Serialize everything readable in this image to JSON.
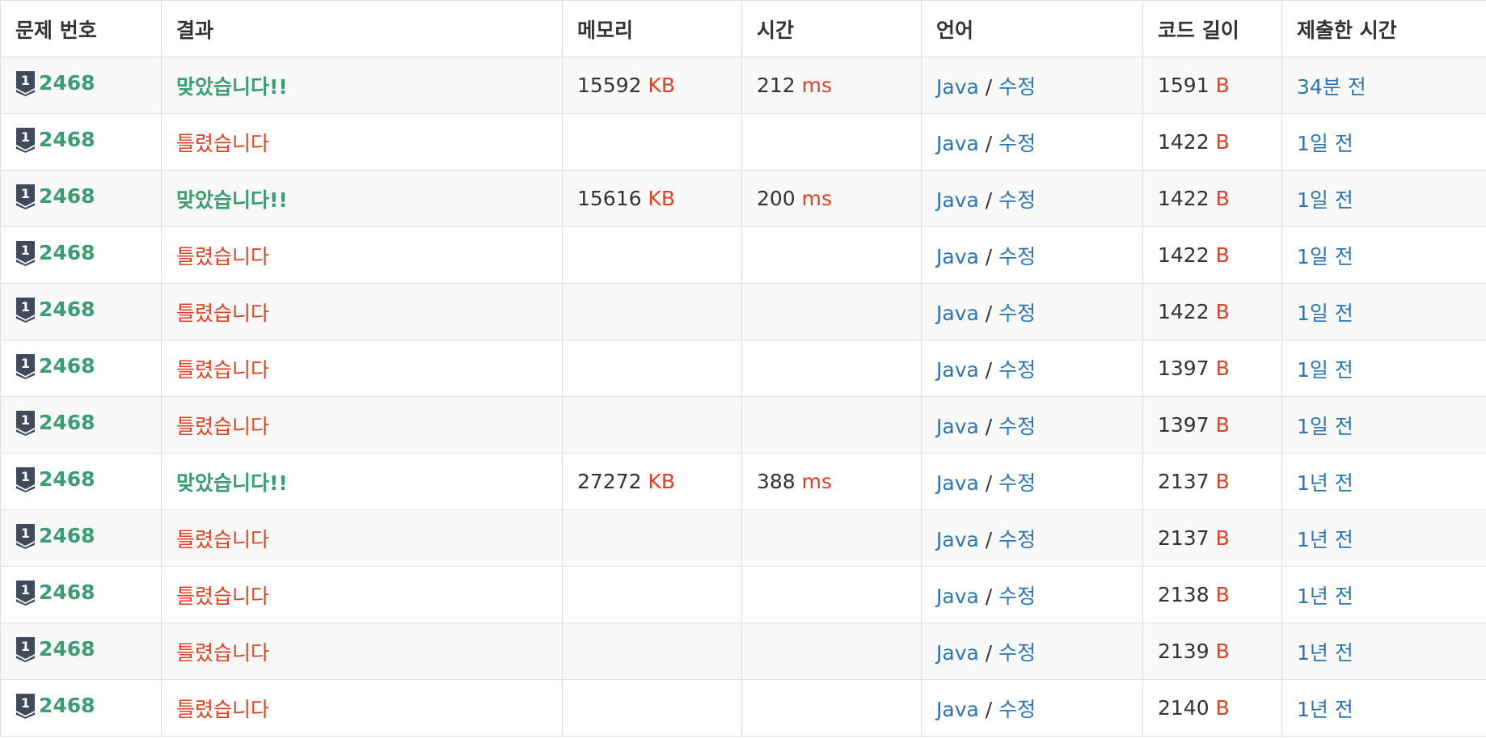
{
  "headers": [
    "문제 번호",
    "결과",
    "메모리",
    "시간",
    "언어",
    "코드 길이",
    "제출한 시간"
  ],
  "colors": {
    "accepted": "#3c9c73",
    "wrong": "#dd4124",
    "link": "#2a74b6",
    "unit": "#dd4124",
    "tier_icon": "#3f4a5c"
  },
  "icons": {
    "problem_tier": "bronze-1-tier-icon"
  },
  "rows": [
    {
      "problem": "2468",
      "result": "맞았습니다!!",
      "status": "ac",
      "memory": "15592",
      "memory_unit": "KB",
      "time": "212",
      "time_unit": "ms",
      "lang": "Java",
      "slash": "/",
      "edit": "수정",
      "code_len": "1591",
      "code_unit": "B",
      "submitted": "34분 전"
    },
    {
      "problem": "2468",
      "result": "틀렸습니다",
      "status": "wa",
      "memory": "",
      "memory_unit": "",
      "time": "",
      "time_unit": "",
      "lang": "Java",
      "slash": "/",
      "edit": "수정",
      "code_len": "1422",
      "code_unit": "B",
      "submitted": "1일 전"
    },
    {
      "problem": "2468",
      "result": "맞았습니다!!",
      "status": "ac",
      "memory": "15616",
      "memory_unit": "KB",
      "time": "200",
      "time_unit": "ms",
      "lang": "Java",
      "slash": "/",
      "edit": "수정",
      "code_len": "1422",
      "code_unit": "B",
      "submitted": "1일 전"
    },
    {
      "problem": "2468",
      "result": "틀렸습니다",
      "status": "wa",
      "memory": "",
      "memory_unit": "",
      "time": "",
      "time_unit": "",
      "lang": "Java",
      "slash": "/",
      "edit": "수정",
      "code_len": "1422",
      "code_unit": "B",
      "submitted": "1일 전"
    },
    {
      "problem": "2468",
      "result": "틀렸습니다",
      "status": "wa",
      "memory": "",
      "memory_unit": "",
      "time": "",
      "time_unit": "",
      "lang": "Java",
      "slash": "/",
      "edit": "수정",
      "code_len": "1422",
      "code_unit": "B",
      "submitted": "1일 전"
    },
    {
      "problem": "2468",
      "result": "틀렸습니다",
      "status": "wa",
      "memory": "",
      "memory_unit": "",
      "time": "",
      "time_unit": "",
      "lang": "Java",
      "slash": "/",
      "edit": "수정",
      "code_len": "1397",
      "code_unit": "B",
      "submitted": "1일 전"
    },
    {
      "problem": "2468",
      "result": "틀렸습니다",
      "status": "wa",
      "memory": "",
      "memory_unit": "",
      "time": "",
      "time_unit": "",
      "lang": "Java",
      "slash": "/",
      "edit": "수정",
      "code_len": "1397",
      "code_unit": "B",
      "submitted": "1일 전"
    },
    {
      "problem": "2468",
      "result": "맞았습니다!!",
      "status": "ac",
      "memory": "27272",
      "memory_unit": "KB",
      "time": "388",
      "time_unit": "ms",
      "lang": "Java",
      "slash": "/",
      "edit": "수정",
      "code_len": "2137",
      "code_unit": "B",
      "submitted": "1년 전"
    },
    {
      "problem": "2468",
      "result": "틀렸습니다",
      "status": "wa",
      "memory": "",
      "memory_unit": "",
      "time": "",
      "time_unit": "",
      "lang": "Java",
      "slash": "/",
      "edit": "수정",
      "code_len": "2137",
      "code_unit": "B",
      "submitted": "1년 전"
    },
    {
      "problem": "2468",
      "result": "틀렸습니다",
      "status": "wa",
      "memory": "",
      "memory_unit": "",
      "time": "",
      "time_unit": "",
      "lang": "Java",
      "slash": "/",
      "edit": "수정",
      "code_len": "2138",
      "code_unit": "B",
      "submitted": "1년 전"
    },
    {
      "problem": "2468",
      "result": "틀렸습니다",
      "status": "wa",
      "memory": "",
      "memory_unit": "",
      "time": "",
      "time_unit": "",
      "lang": "Java",
      "slash": "/",
      "edit": "수정",
      "code_len": "2139",
      "code_unit": "B",
      "submitted": "1년 전"
    },
    {
      "problem": "2468",
      "result": "틀렸습니다",
      "status": "wa",
      "memory": "",
      "memory_unit": "",
      "time": "",
      "time_unit": "",
      "lang": "Java",
      "slash": "/",
      "edit": "수정",
      "code_len": "2140",
      "code_unit": "B",
      "submitted": "1년 전"
    }
  ]
}
